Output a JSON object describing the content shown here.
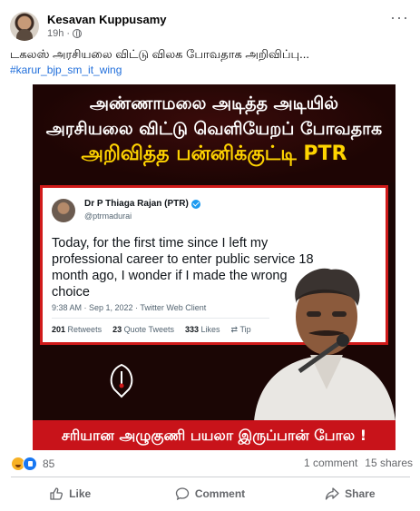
{
  "post": {
    "author": "Kesavan Kuppusamy",
    "time": "19h",
    "text": "டகலஸ் அரசியலை விட்டு விலக போவதாக அறிவிப்பு...",
    "hashtag": "#karur_bjp_sm_it_wing",
    "more_icon": "more-options-icon"
  },
  "image": {
    "headline_line1": "அண்ணாமலை அடித்த அடியில்",
    "headline_line2": "அரசியலை விட்டு வெளியேறப் போவதாக",
    "headline_line3": "அறிவித்த பன்னிக்குட்டி PTR",
    "tweet": {
      "name": "Dr P Thiaga Rajan (PTR)",
      "handle": "@ptrmadurai",
      "body": "Today, for the first time since I left my professional career to enter public service 18 month ago, I wonder if I made the wrong choice",
      "timestamp": "9:38 AM · Sep 1, 2022 · Twitter Web Client",
      "retweets_count": "201",
      "retweets_label": "Retweets",
      "quotes_count": "23",
      "quotes_label": "Quote Tweets",
      "likes_count": "333",
      "likes_label": "Likes",
      "tip_label": "Tip"
    },
    "bottom_caption": "சரியான அழுகுணி பயலா இருப்பான் போல !"
  },
  "engagement": {
    "reaction_count": "85",
    "comments": "1 comment",
    "shares": "15 shares"
  },
  "actions": {
    "like": "Like",
    "comment": "Comment",
    "share": "Share"
  },
  "colors": {
    "link": "#216fdb",
    "banner_red": "#c8131a",
    "headline_yellow": "#ffd400"
  }
}
